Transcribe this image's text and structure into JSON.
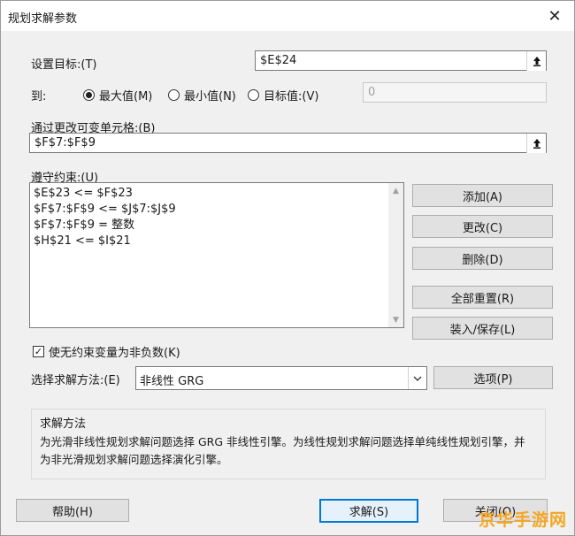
{
  "window": {
    "title": "规划求解参数"
  },
  "objective": {
    "label": "设置目标:(T)",
    "value": "$E$24"
  },
  "to": {
    "label": "到:",
    "options": [
      {
        "label": "最大值(M)",
        "selected": true
      },
      {
        "label": "最小值(N)",
        "selected": false
      },
      {
        "label": "目标值:(V)",
        "selected": false
      }
    ],
    "target_value": "0"
  },
  "variable_cells": {
    "label": "通过更改可变单元格:(B)",
    "value": "$F$7:$F$9"
  },
  "constraints": {
    "label": "遵守约束:(U)",
    "items": [
      "$E$23 <= $F$23",
      "$F$7:$F$9 <= $J$7:$J$9",
      "$F$7:$F$9 = 整数",
      "$H$21 <= $I$21"
    ],
    "buttons": {
      "add": "添加(A)",
      "change": "更改(C)",
      "delete": "删除(D)",
      "reset_all": "全部重置(R)",
      "load_save": "装入/保存(L)"
    }
  },
  "non_negative": {
    "label": "使无约束变量为非负数(K)",
    "checked": true
  },
  "method": {
    "label": "选择求解方法:(E)",
    "value": "非线性 GRG",
    "options_button": "选项(P)"
  },
  "method_group": {
    "title": "求解方法",
    "description": "为光滑非线性规划求解问题选择 GRG 非线性引擎。为线性规划求解问题选择单纯线性规划引擎，并为非光滑规划求解问题选择演化引擎。"
  },
  "footer": {
    "help": "帮助(H)",
    "solve": "求解(S)",
    "close": "关闭(O)"
  },
  "watermark": "京华手游网",
  "colors": {
    "accent": "#0078d7",
    "watermark": "#f5a623"
  }
}
